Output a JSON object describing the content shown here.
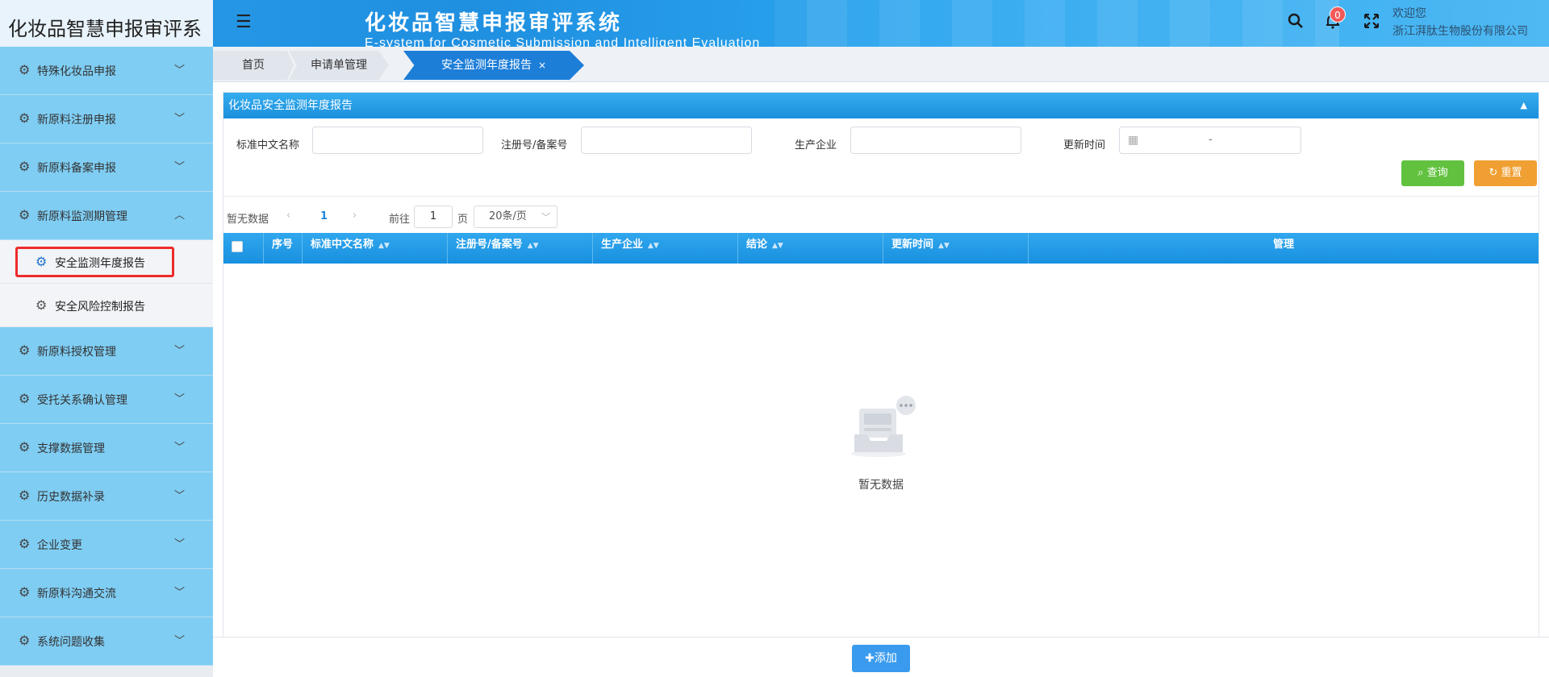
{
  "header": {
    "logo_text": "化妆品智慧申报审评系统",
    "brand_cn": "化妆品智慧申报审评系统",
    "brand_en": "E-system for Cosmetic Submission and Intelligent Evaluation",
    "notification_count": "0",
    "welcome_line1": "欢迎您",
    "welcome_line2": "浙江湃肽生物股份有限公司"
  },
  "sidebar": {
    "items": [
      {
        "label": "特殊化妆品申报",
        "expanded": false
      },
      {
        "label": "新原料注册申报",
        "expanded": false
      },
      {
        "label": "新原料备案申报",
        "expanded": false
      },
      {
        "label": "新原料监测期管理",
        "expanded": true
      }
    ],
    "sub_items": [
      {
        "label": "安全监测年度报告",
        "active": true
      },
      {
        "label": "安全风险控制报告",
        "active": false
      }
    ],
    "items_after": [
      {
        "label": "新原料授权管理"
      },
      {
        "label": "受托关系确认管理"
      },
      {
        "label": "支撑数据管理"
      },
      {
        "label": "历史数据补录"
      },
      {
        "label": "企业变更"
      },
      {
        "label": "新原料沟通交流"
      },
      {
        "label": "系统问题收集"
      }
    ]
  },
  "tabs": [
    {
      "label": "首页"
    },
    {
      "label": "申请单管理"
    },
    {
      "label": "安全监测年度报告",
      "close": "×",
      "active": true
    }
  ],
  "panel": {
    "title": "化妆品安全监测年度报告",
    "collapse_glyph": "▲"
  },
  "filters": {
    "name_label": "标准中文名称",
    "reg_label": "注册号/备案号",
    "company_label": "生产企业",
    "time_label": "更新时间",
    "date_separator": "-",
    "query_label": "查询",
    "reset_label": "重置"
  },
  "pagination": {
    "status": "暂无数据",
    "current_page": "1",
    "goto_label": "前往",
    "goto_value": "1",
    "page_unit": "页",
    "page_size": "20条/页"
  },
  "table": {
    "columns": [
      "序号",
      "标准中文名称",
      "注册号/备案号",
      "生产企业",
      "结论",
      "更新时间",
      "管理"
    ],
    "rows": [],
    "empty_text": "暂无数据"
  },
  "footer": {
    "add_label": "✚添加"
  },
  "colors": {
    "accent": "#1d7ed8",
    "sidebar": "#7fcdf3",
    "query": "#62c23f",
    "reset": "#f0a032",
    "highlight": "#ee2b2b"
  }
}
